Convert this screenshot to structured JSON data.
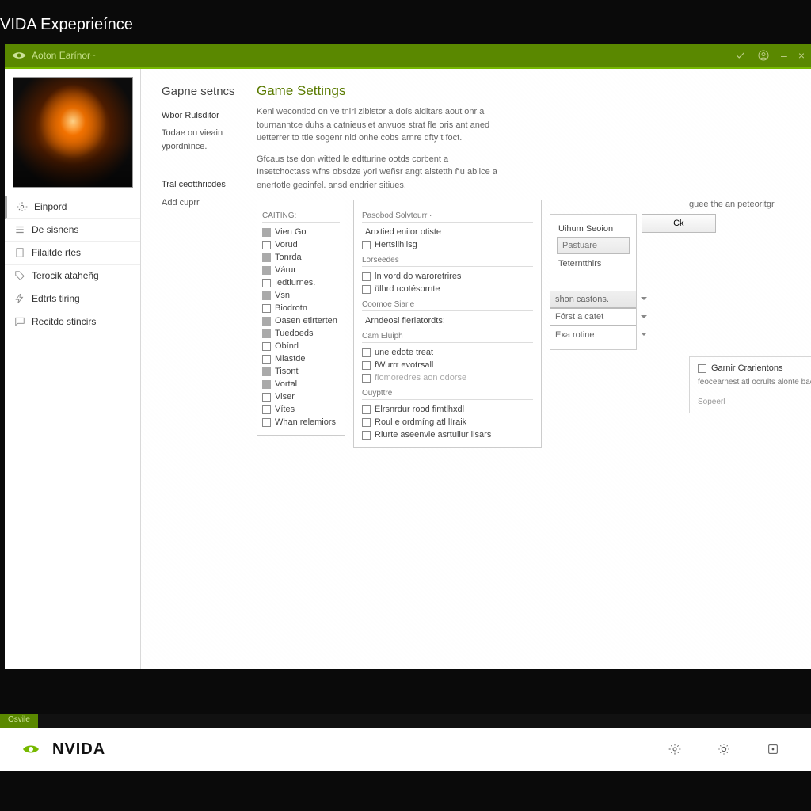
{
  "app_title": "VIDA Expeprieínce",
  "topbar": {
    "title": "Aoton Earínor~",
    "minimize": "–",
    "close": "×"
  },
  "sidebar": {
    "emport": "Einpord",
    "items": [
      {
        "label": "De sisnens"
      },
      {
        "label": "Filaitde rtes"
      },
      {
        "label": "Terocik ataheñg"
      },
      {
        "label": "Edtrts tiring"
      },
      {
        "label": "Recitdo stincirs"
      }
    ]
  },
  "left": {
    "header": "Gapne setncs",
    "sub1": "Wbor Rulsditor",
    "sub2": "Todae ou vieain ypordnínce.",
    "sub3": "Tral ceotthricdes",
    "sub4": "Add cuprr"
  },
  "main": {
    "title": "Game Settings",
    "p1": "Kenl wecontiod on ve tniri zibistor a doís alditars aout onr a tournanntce duhs a catnieusiet anvuos strat fle oris ant aned uetterrer to ttie sogenr nid onhe cobs arnre dfty t foct.",
    "p2": "Gfcaus tse don witted le edtturine ootds corbent a Insetchoctass wfns obsdze yori weñsr angt aistetth ñu abiice a enertotle geoinfel. ansd endrier sitiues."
  },
  "p1": {
    "grp": "CAITING:",
    "items": [
      "Vien Go",
      "Vorud",
      "Tonrda",
      "Várur",
      "Iedtiurnes.",
      "Vsn",
      "Biodrotn",
      "Oasen etirterten",
      "Tuedoeds",
      "Obínrl",
      "Miastde",
      "Tisont",
      "Vortal",
      "Viser",
      "Vítes",
      "Whan relemiors"
    ]
  },
  "p2": {
    "grp1": "Pasobod Solvteurr  ·",
    "c1": "Anxtied eniior otiste",
    "c2": "Hertslihiisg",
    "grp2": "Lorseedes",
    "c3": "ln vord do waroretrires",
    "c4": "ülhrd rcotésornte",
    "grp3": "Coomoe Siarle",
    "sub": "Arndeosi fleriatordts:",
    "grp4": "Cam Eluiph",
    "c5": "une edote treat",
    "c6": "fWurrr evotrsall",
    "c7": "fiomoredres aon odorse",
    "grp5": "Ouypttre",
    "c8": "Elrsnrdur rood fimtlhxdl",
    "c9": "Roul e ordmíng atl lIraik",
    "c10": "Riurte aseenvie asrtuiiur lisars"
  },
  "right": {
    "hint": "guee the an peteoritgr",
    "ok": "Ck",
    "section": "Uihum Seoion",
    "placeholder": "Pastuare",
    "tlabel": "Teterntthirs",
    "d1": "shon castons.",
    "d2": "Fórst a catet",
    "d3": "Exa rotine",
    "note_title": "Garnir Crarientons",
    "note_line": "feocearnest atl ocrults alonte bacinvarte",
    "note_sep": "Sopeerl"
  },
  "footer": {
    "tag": "Osvile",
    "brand": "NVIDA"
  }
}
